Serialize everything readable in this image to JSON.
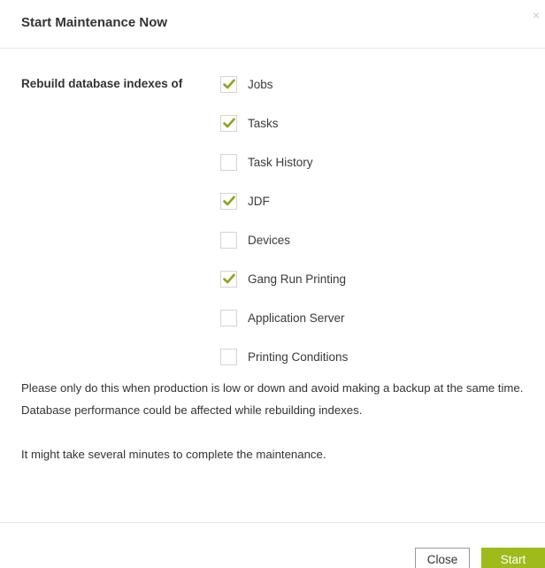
{
  "dialog": {
    "title": "Start Maintenance Now",
    "close_glyph": "×",
    "rebuild_label": "Rebuild database indexes of"
  },
  "checkboxes": [
    {
      "label": "Jobs",
      "checked": true
    },
    {
      "label": "Tasks",
      "checked": true
    },
    {
      "label": "Task History",
      "checked": false
    },
    {
      "label": "JDF",
      "checked": true
    },
    {
      "label": "Devices",
      "checked": false
    },
    {
      "label": "Gang Run Printing",
      "checked": true
    },
    {
      "label": "Application Server",
      "checked": false
    },
    {
      "label": "Printing Conditions",
      "checked": false
    }
  ],
  "notes": {
    "line1": "Please only do this when production is low or down and avoid making a backup at the same time.",
    "line2": "Database performance could be affected while rebuilding indexes.",
    "line3": "It might take several minutes to complete the maintenance."
  },
  "footer": {
    "close_label": "Close",
    "start_label": "Start"
  },
  "colors": {
    "accent": "#9fbb1b",
    "check": "#8aa619"
  }
}
